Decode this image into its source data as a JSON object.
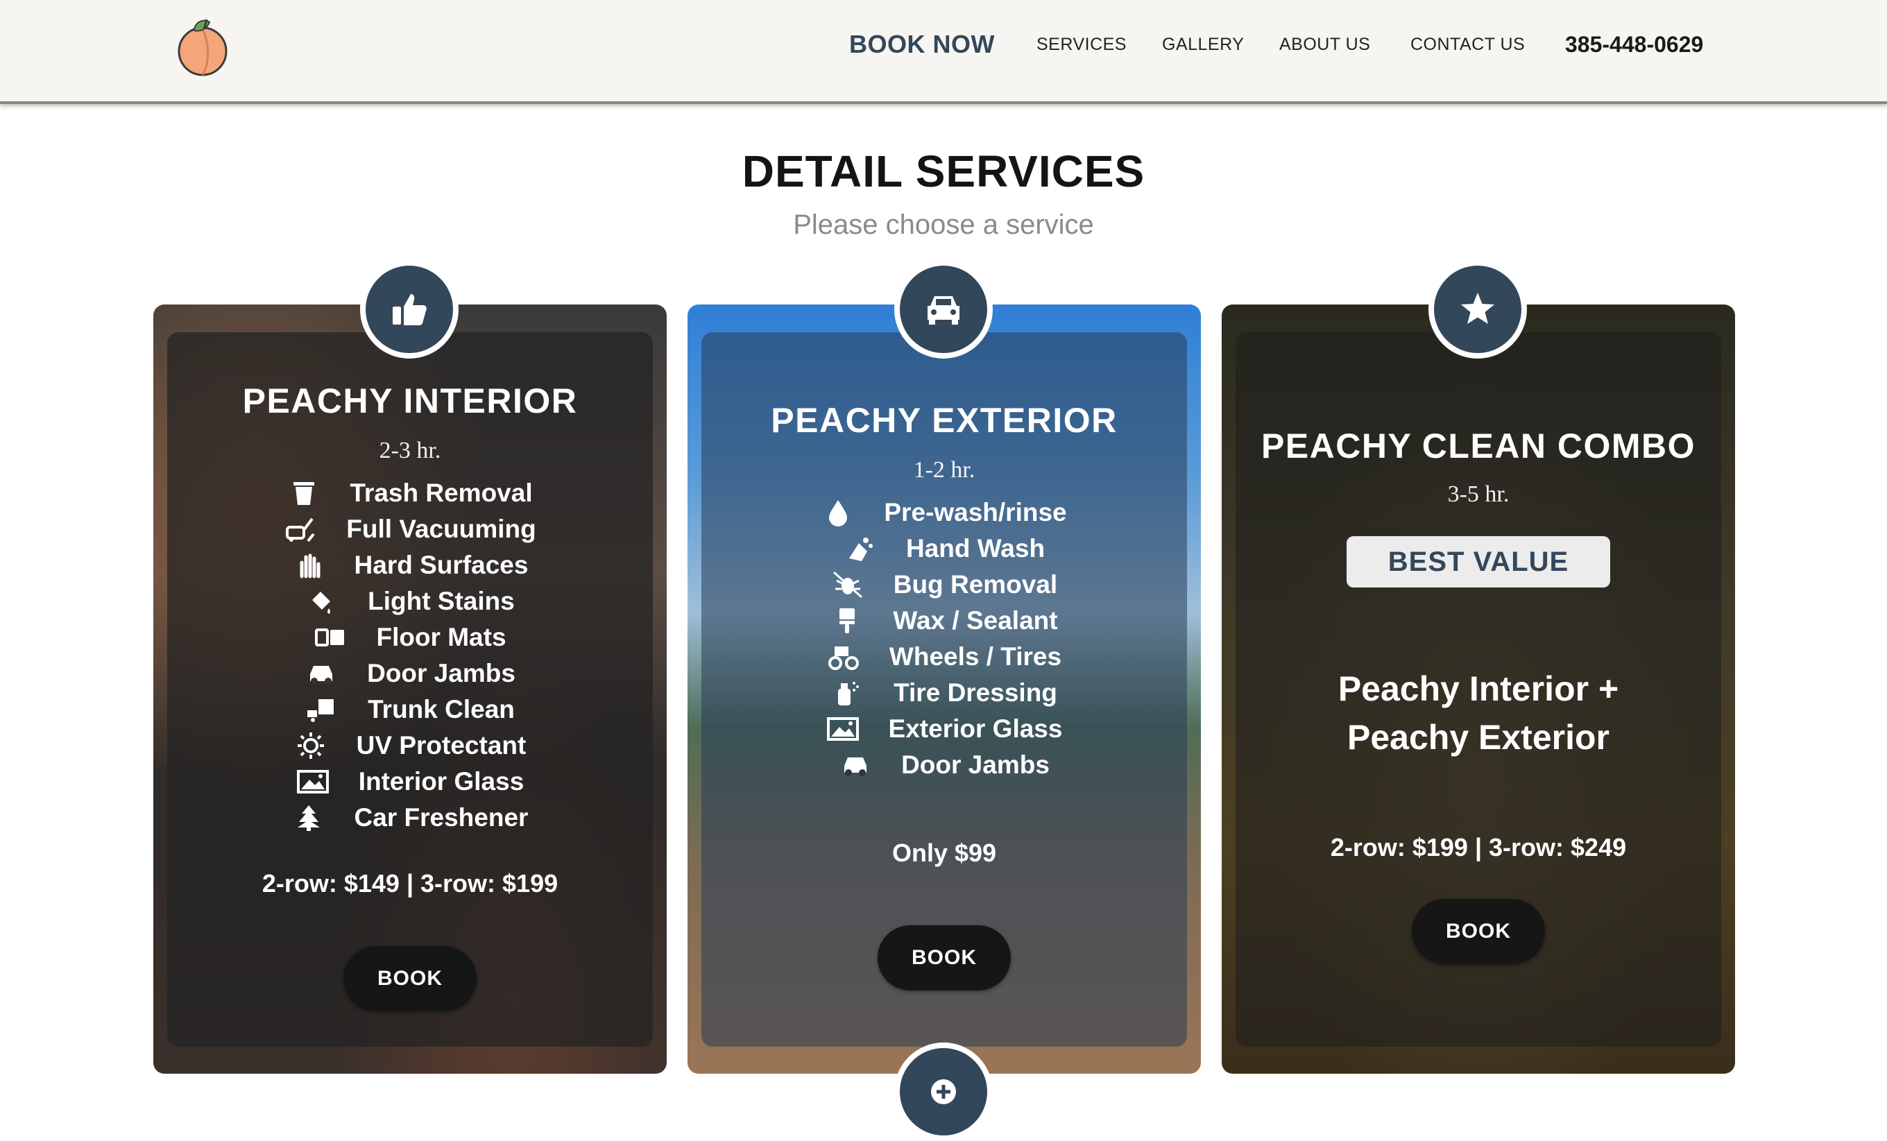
{
  "header": {
    "logo_icon": "peach-icon",
    "book_now": "BOOK NOW",
    "nav": [
      "SERVICES",
      "GALLERY",
      "ABOUT US",
      "CONTACT US"
    ],
    "phone": "385-448-0629"
  },
  "section": {
    "title": "DETAIL SERVICES",
    "subtitle": "Please choose a service"
  },
  "cards": [
    {
      "icon": "thumbs-up-icon",
      "title": "PEACHY INTERIOR",
      "time": "2-3 hr.",
      "features": [
        {
          "icon": "trash-icon",
          "label": "Trash Removal"
        },
        {
          "icon": "vacuum-icon",
          "label": "Full Vacuuming"
        },
        {
          "icon": "hand-sparkle-icon",
          "label": "Hard Surfaces"
        },
        {
          "icon": "spray-icon",
          "label": "Light Stains"
        },
        {
          "icon": "mat-icon",
          "label": "Floor Mats"
        },
        {
          "icon": "car-icon",
          "label": "Door Jambs"
        },
        {
          "icon": "truck-loading-icon",
          "label": "Trunk Clean"
        },
        {
          "icon": "sun-icon",
          "label": "UV Protectant"
        },
        {
          "icon": "image-icon",
          "label": "Interior Glass"
        },
        {
          "icon": "tree-icon",
          "label": "Car Freshener"
        }
      ],
      "price": "2-row: $149 | 3-row: $199",
      "button": "BOOK"
    },
    {
      "icon": "car-front-icon",
      "title": "PEACHY EXTERIOR",
      "time": "1-2 hr.",
      "features": [
        {
          "icon": "droplet-icon",
          "label": "Pre-wash/rinse"
        },
        {
          "icon": "hands-wash-icon",
          "label": "Hand Wash"
        },
        {
          "icon": "bug-slash-icon",
          "label": "Bug Removal"
        },
        {
          "icon": "paint-brush-icon",
          "label": "Wax / Sealant"
        },
        {
          "icon": "tractor-icon",
          "label": "Wheels / Tires"
        },
        {
          "icon": "spray-can-icon",
          "label": "Tire Dressing"
        },
        {
          "icon": "image-icon",
          "label": "Exterior Glass"
        },
        {
          "icon": "car-icon",
          "label": "Door Jambs"
        }
      ],
      "price": "Only $99",
      "button": "BOOK"
    },
    {
      "icon": "star-icon",
      "title": "PEACHY CLEAN COMBO",
      "time": "3-5 hr.",
      "badge": "BEST VALUE",
      "combo_line1": "Peachy Interior +",
      "combo_line2": "Peachy Exterior",
      "price": "2-row: $199 | 3-row: $249",
      "button": "BOOK"
    }
  ],
  "next_icon": "plus-icon"
}
